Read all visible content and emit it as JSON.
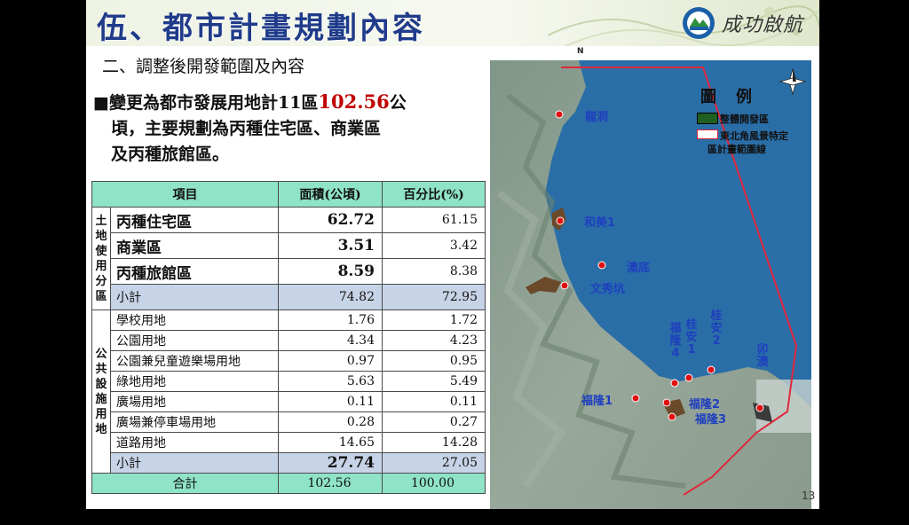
{
  "header": {
    "title": "伍、都市計畫規劃內容",
    "logo_text": "成功啟航"
  },
  "subtitle": "二、調整後開發範圍及內容",
  "bullet": {
    "marker": "■",
    "pre": "變更為都市發展用地計11區",
    "highlight": "102.56",
    "post": "公",
    "line2": "頃，主要規劃為丙種住宅區、商業區",
    "line3": "及丙種旅館區。"
  },
  "table": {
    "headers": [
      "項目",
      "面積(公頃)",
      "百分比(%)"
    ],
    "land_use_label": "土地使用分區",
    "land_use_rows": [
      {
        "name": "丙種住宅區",
        "area": "62.72",
        "percent": "61.15"
      },
      {
        "name": "商業區",
        "area": "3.51",
        "percent": "3.42"
      },
      {
        "name": "丙種旅館區",
        "area": "8.59",
        "percent": "8.38"
      }
    ],
    "land_use_subtotal": {
      "name": "小計",
      "area": "74.82",
      "percent": "72.95"
    },
    "public_label": "公共設施用地",
    "public_rows": [
      {
        "name": "學校用地",
        "area": "1.76",
        "percent": "1.72"
      },
      {
        "name": "公園用地",
        "area": "4.34",
        "percent": "4.23"
      },
      {
        "name": "公園兼兒童遊樂場用地",
        "area": "0.97",
        "percent": "0.95"
      },
      {
        "name": "綠地用地",
        "area": "5.63",
        "percent": "5.49"
      },
      {
        "name": "廣場用地",
        "area": "0.11",
        "percent": "0.11"
      },
      {
        "name": "廣場兼停車場用地",
        "area": "0.28",
        "percent": "0.27"
      },
      {
        "name": "道路用地",
        "area": "14.65",
        "percent": "14.28"
      }
    ],
    "public_subtotal": {
      "name": "小計",
      "area": "27.74",
      "percent": "27.05"
    },
    "total": {
      "name": "合計",
      "area": "102.56",
      "percent": "100.00"
    }
  },
  "map": {
    "legend_title": "圖例",
    "legend_items": [
      "整體開發區",
      "東北角風景特定",
      "區計畫範圍線"
    ],
    "north": "N",
    "places": [
      "龍洞",
      "和美1",
      "澳底",
      "文秀坑",
      "福隆4",
      "桂安1",
      "桂安2",
      "卯澳",
      "福隆1",
      "福隆2",
      "福隆3"
    ]
  },
  "page_number": "13",
  "colors": {
    "title": "#1f3b8a",
    "highlight_red": "#c00000",
    "table_header": "#8fe3c7",
    "subtotal_row": "#c7d3e6",
    "place_label": "#1f3fbf",
    "boundary_line": "#e0283c"
  }
}
